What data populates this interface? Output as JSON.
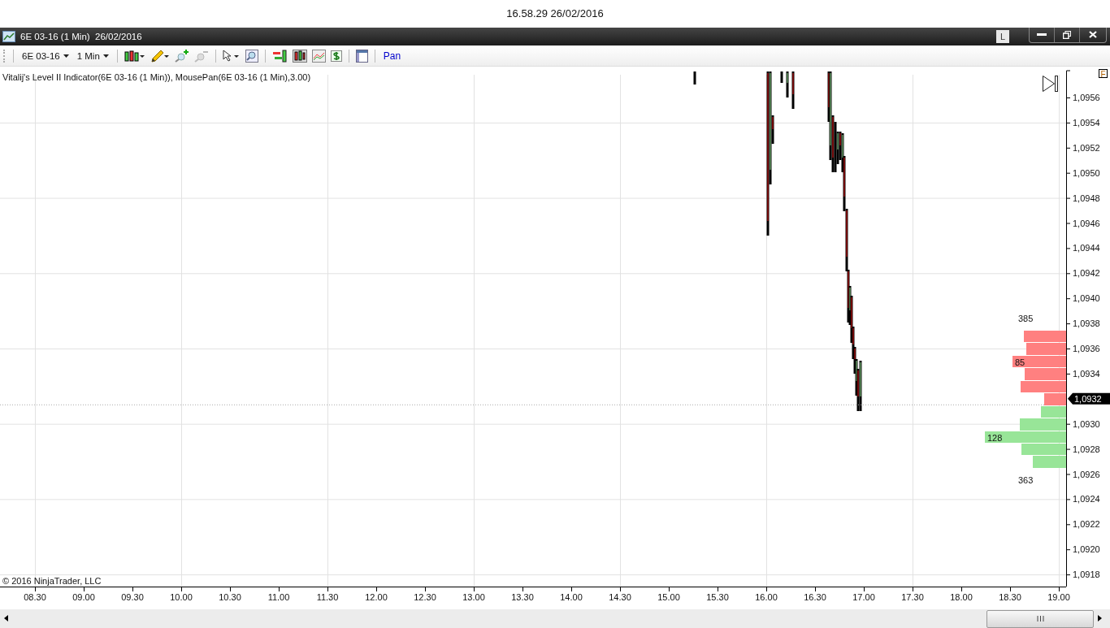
{
  "window_title": "16.58.29 26/02/2016",
  "chart_window": {
    "title": "6E 03-16 (1 Min)  26/02/2016",
    "link_button": "L"
  },
  "toolbar": {
    "instrument": "6E 03-16",
    "interval": "1 Min",
    "pan_label": "Pan"
  },
  "chart": {
    "indicator_label": "Vitalij's Level II Indicator(6E 03-16 (1 Min)), MousePan(6E 03-16 (1 Min),3.00)",
    "copyright": "© 2016 NinjaTrader, LLC",
    "scale_button": "F",
    "price_ticks": [
      {
        "label": "1,0956",
        "current": false
      },
      {
        "label": "1,0954",
        "current": false
      },
      {
        "label": "1,0952",
        "current": false
      },
      {
        "label": "1,0950",
        "current": false
      },
      {
        "label": "1,0948",
        "current": false
      },
      {
        "label": "1,0946",
        "current": false
      },
      {
        "label": "1,0944",
        "current": false
      },
      {
        "label": "1,0942",
        "current": false
      },
      {
        "label": "1,0940",
        "current": false
      },
      {
        "label": "1,0938",
        "current": false
      },
      {
        "label": "1,0936",
        "current": false
      },
      {
        "label": "1,0934",
        "current": false
      },
      {
        "label": "1,0932",
        "current": true
      },
      {
        "label": "1,0930",
        "current": false
      },
      {
        "label": "1,0928",
        "current": false
      },
      {
        "label": "1,0926",
        "current": false
      },
      {
        "label": "1,0924",
        "current": false
      },
      {
        "label": "1,0922",
        "current": false
      },
      {
        "label": "1,0920",
        "current": false
      },
      {
        "label": "1,0918",
        "current": false
      }
    ],
    "time_ticks": [
      "08.30",
      "09.00",
      "09.30",
      "10.00",
      "10.30",
      "11.00",
      "11.30",
      "12.00",
      "12.30",
      "13.00",
      "13.30",
      "14.00",
      "14.30",
      "15.00",
      "15.30",
      "16.00",
      "16.30",
      "17.00",
      "17.30",
      "18.00",
      "18.30",
      "19.00"
    ],
    "ask_total": "385",
    "bid_total": "363",
    "depth_levels": [
      {
        "kind": "ask"
      },
      {
        "kind": "ask"
      },
      {
        "kind": "ask",
        "label": "85"
      },
      {
        "kind": "ask"
      },
      {
        "kind": "ask"
      },
      {
        "kind": "ask"
      },
      {
        "kind": "bid"
      },
      {
        "kind": "bid"
      },
      {
        "kind": "bid",
        "label": "128"
      },
      {
        "kind": "bid"
      },
      {
        "kind": "bid"
      }
    ]
  }
}
